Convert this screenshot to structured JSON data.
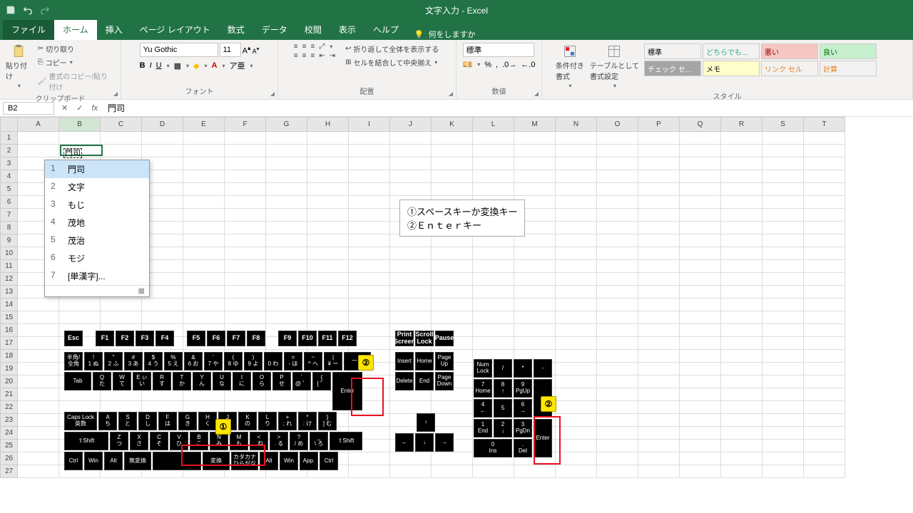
{
  "titlebar": {
    "title": "文字入力 - Excel"
  },
  "tabs": {
    "file": "ファイル",
    "items": [
      "ホーム",
      "挿入",
      "ページ レイアウト",
      "数式",
      "データ",
      "校閲",
      "表示",
      "ヘルプ"
    ],
    "active": 0,
    "tellme": "何をしますか"
  },
  "ribbon": {
    "clipboard": {
      "label": "クリップボード",
      "paste": "貼り付け",
      "cut": "切り取り",
      "copy": "コピー",
      "fmtpainter": "書式のコピー/貼り付け"
    },
    "font": {
      "label": "フォント",
      "name": "Yu Gothic",
      "size": "11"
    },
    "align": {
      "label": "配置",
      "wrap": "折り返して全体を表示する",
      "merge": "セルを結合して中央揃え"
    },
    "number": {
      "label": "数値",
      "format": "標準"
    },
    "styles": {
      "label": "スタイル",
      "cond": "条件付き\n書式",
      "table": "テーブルとして\n書式設定",
      "cells": [
        "標準",
        "どちらでも...",
        "悪い",
        "良い",
        "チェック セ...",
        "メモ",
        "リンク セル",
        "計算"
      ]
    }
  },
  "formula_bar": {
    "namebox": "B2",
    "value": "門司"
  },
  "grid": {
    "cols": [
      "A",
      "B",
      "C",
      "D",
      "E",
      "F",
      "G",
      "H",
      "I",
      "J",
      "K",
      "L",
      "M",
      "N",
      "O",
      "P",
      "Q",
      "R",
      "S",
      "T"
    ],
    "rows": 27,
    "active_col": "B",
    "cell_edit": {
      "value": "門司"
    }
  },
  "ime": {
    "items": [
      {
        "n": "1",
        "t": "門司"
      },
      {
        "n": "2",
        "t": "文字"
      },
      {
        "n": "3",
        "t": "もじ"
      },
      {
        "n": "4",
        "t": "茂地"
      },
      {
        "n": "5",
        "t": "茂治"
      },
      {
        "n": "6",
        "t": "モジ"
      },
      {
        "n": "7",
        "t": "[単漢字]..."
      }
    ],
    "selected": 0
  },
  "annotation": {
    "line1": "①スペースキーか変換キー",
    "line2": "②Ｅｎｔｅｒキー"
  },
  "keyboard": {
    "fn_row": [
      "Esc",
      "",
      "F1",
      "F2",
      "F3",
      "F4",
      "",
      "F5",
      "F6",
      "F7",
      "F8",
      "",
      "F9",
      "F10",
      "F11",
      "F12"
    ],
    "side_fn": [
      "Print\nScreen",
      "Scroll\nLock",
      "Pause"
    ],
    "row1": [
      "半角/\n全角",
      "!\n1 ぬ",
      "\"\n2 ふ",
      "#\n3 あ",
      "$\n4 う",
      "%\n5 え",
      "&\n6 お",
      "'\n7 や",
      "(\n8 ゆ",
      ")\n9 よ",
      "\n0 わ",
      "=\n- ほ",
      "~\n^ へ",
      "|\n¥ ー"
    ],
    "row2": [
      "Tab",
      "Q\nた",
      "W\nて",
      "E ぃ\nい",
      "R\nす",
      "T\nか",
      "Y\nん",
      "U\nな",
      "I\nに",
      "O\nら",
      "P\nせ",
      "`\n@ ゛",
      "{\n[ ゜"
    ],
    "row3": [
      "Caps Lock\n英数",
      "A\nち",
      "S\nと",
      "D\nし",
      "F\nは",
      "G\nき",
      "H\nく",
      "J\nま",
      "K\nの",
      "L\nり",
      "+\n; れ",
      "*\n: け",
      "}\n] む"
    ],
    "row4": [
      "⇧Shift",
      "Z\nつ",
      "X\nさ",
      "C\nそ",
      "V\nひ",
      "B\nこ",
      "N\nみ",
      "M\nも",
      "<\n, ね",
      ">\n. る",
      "?\n/ め",
      "_\n\\ ろ",
      "⇧Shift"
    ],
    "row5": [
      "Ctrl",
      "Win",
      "Alt",
      "無変換",
      "",
      "変換",
      "カタカナ\nひらがな",
      "Alt",
      "Win",
      "App.",
      "Ctrl"
    ],
    "nav1": [
      "Insert",
      "Home",
      "Page\nUp"
    ],
    "nav2": [
      "Delete",
      "End",
      "Page\nDown"
    ],
    "arrows": {
      "up": "↑",
      "left": "←",
      "down": "↓",
      "right": "→"
    },
    "numpad": {
      "r0": [
        "Num\nLock",
        "/",
        "*",
        "-"
      ],
      "r1": [
        "7\nHome",
        "8\n↑",
        "9\nPgUp"
      ],
      "r2": [
        "4\n←",
        "5",
        "6\n→"
      ],
      "r3": [
        "1\nEnd",
        "2\n↓",
        "3\nPgDn"
      ],
      "r4": [
        "0\nIns",
        ".\nDel"
      ],
      "plus": "+",
      "enter": "Enter"
    },
    "enter": "Enter",
    "bksp": "一々"
  },
  "markers": {
    "m1": "①",
    "m2": "②"
  }
}
